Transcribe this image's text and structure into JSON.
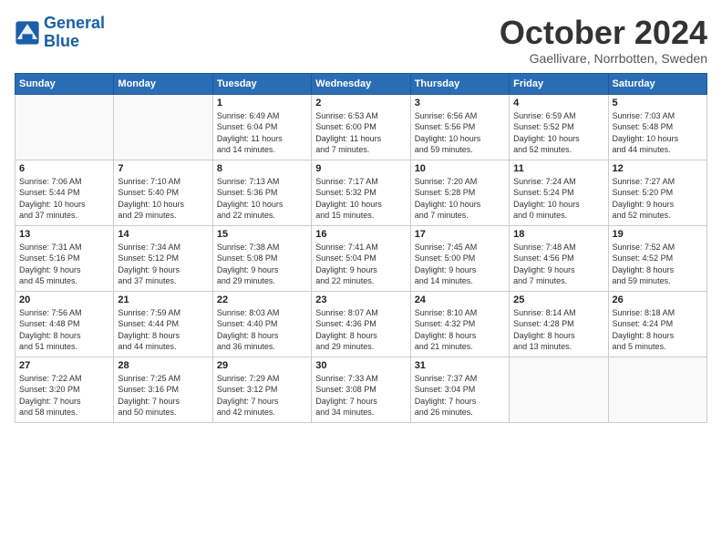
{
  "header": {
    "logo_line1": "General",
    "logo_line2": "Blue",
    "month": "October 2024",
    "location": "Gaellivare, Norrbotten, Sweden"
  },
  "weekdays": [
    "Sunday",
    "Monday",
    "Tuesday",
    "Wednesday",
    "Thursday",
    "Friday",
    "Saturday"
  ],
  "weeks": [
    [
      {
        "day": "",
        "info": ""
      },
      {
        "day": "",
        "info": ""
      },
      {
        "day": "1",
        "info": "Sunrise: 6:49 AM\nSunset: 6:04 PM\nDaylight: 11 hours\nand 14 minutes."
      },
      {
        "day": "2",
        "info": "Sunrise: 6:53 AM\nSunset: 6:00 PM\nDaylight: 11 hours\nand 7 minutes."
      },
      {
        "day": "3",
        "info": "Sunrise: 6:56 AM\nSunset: 5:56 PM\nDaylight: 10 hours\nand 59 minutes."
      },
      {
        "day": "4",
        "info": "Sunrise: 6:59 AM\nSunset: 5:52 PM\nDaylight: 10 hours\nand 52 minutes."
      },
      {
        "day": "5",
        "info": "Sunrise: 7:03 AM\nSunset: 5:48 PM\nDaylight: 10 hours\nand 44 minutes."
      }
    ],
    [
      {
        "day": "6",
        "info": "Sunrise: 7:06 AM\nSunset: 5:44 PM\nDaylight: 10 hours\nand 37 minutes."
      },
      {
        "day": "7",
        "info": "Sunrise: 7:10 AM\nSunset: 5:40 PM\nDaylight: 10 hours\nand 29 minutes."
      },
      {
        "day": "8",
        "info": "Sunrise: 7:13 AM\nSunset: 5:36 PM\nDaylight: 10 hours\nand 22 minutes."
      },
      {
        "day": "9",
        "info": "Sunrise: 7:17 AM\nSunset: 5:32 PM\nDaylight: 10 hours\nand 15 minutes."
      },
      {
        "day": "10",
        "info": "Sunrise: 7:20 AM\nSunset: 5:28 PM\nDaylight: 10 hours\nand 7 minutes."
      },
      {
        "day": "11",
        "info": "Sunrise: 7:24 AM\nSunset: 5:24 PM\nDaylight: 10 hours\nand 0 minutes."
      },
      {
        "day": "12",
        "info": "Sunrise: 7:27 AM\nSunset: 5:20 PM\nDaylight: 9 hours\nand 52 minutes."
      }
    ],
    [
      {
        "day": "13",
        "info": "Sunrise: 7:31 AM\nSunset: 5:16 PM\nDaylight: 9 hours\nand 45 minutes."
      },
      {
        "day": "14",
        "info": "Sunrise: 7:34 AM\nSunset: 5:12 PM\nDaylight: 9 hours\nand 37 minutes."
      },
      {
        "day": "15",
        "info": "Sunrise: 7:38 AM\nSunset: 5:08 PM\nDaylight: 9 hours\nand 29 minutes."
      },
      {
        "day": "16",
        "info": "Sunrise: 7:41 AM\nSunset: 5:04 PM\nDaylight: 9 hours\nand 22 minutes."
      },
      {
        "day": "17",
        "info": "Sunrise: 7:45 AM\nSunset: 5:00 PM\nDaylight: 9 hours\nand 14 minutes."
      },
      {
        "day": "18",
        "info": "Sunrise: 7:48 AM\nSunset: 4:56 PM\nDaylight: 9 hours\nand 7 minutes."
      },
      {
        "day": "19",
        "info": "Sunrise: 7:52 AM\nSunset: 4:52 PM\nDaylight: 8 hours\nand 59 minutes."
      }
    ],
    [
      {
        "day": "20",
        "info": "Sunrise: 7:56 AM\nSunset: 4:48 PM\nDaylight: 8 hours\nand 51 minutes."
      },
      {
        "day": "21",
        "info": "Sunrise: 7:59 AM\nSunset: 4:44 PM\nDaylight: 8 hours\nand 44 minutes."
      },
      {
        "day": "22",
        "info": "Sunrise: 8:03 AM\nSunset: 4:40 PM\nDaylight: 8 hours\nand 36 minutes."
      },
      {
        "day": "23",
        "info": "Sunrise: 8:07 AM\nSunset: 4:36 PM\nDaylight: 8 hours\nand 29 minutes."
      },
      {
        "day": "24",
        "info": "Sunrise: 8:10 AM\nSunset: 4:32 PM\nDaylight: 8 hours\nand 21 minutes."
      },
      {
        "day": "25",
        "info": "Sunrise: 8:14 AM\nSunset: 4:28 PM\nDaylight: 8 hours\nand 13 minutes."
      },
      {
        "day": "26",
        "info": "Sunrise: 8:18 AM\nSunset: 4:24 PM\nDaylight: 8 hours\nand 5 minutes."
      }
    ],
    [
      {
        "day": "27",
        "info": "Sunrise: 7:22 AM\nSunset: 3:20 PM\nDaylight: 7 hours\nand 58 minutes."
      },
      {
        "day": "28",
        "info": "Sunrise: 7:25 AM\nSunset: 3:16 PM\nDaylight: 7 hours\nand 50 minutes."
      },
      {
        "day": "29",
        "info": "Sunrise: 7:29 AM\nSunset: 3:12 PM\nDaylight: 7 hours\nand 42 minutes."
      },
      {
        "day": "30",
        "info": "Sunrise: 7:33 AM\nSunset: 3:08 PM\nDaylight: 7 hours\nand 34 minutes."
      },
      {
        "day": "31",
        "info": "Sunrise: 7:37 AM\nSunset: 3:04 PM\nDaylight: 7 hours\nand 26 minutes."
      },
      {
        "day": "",
        "info": ""
      },
      {
        "day": "",
        "info": ""
      }
    ]
  ]
}
